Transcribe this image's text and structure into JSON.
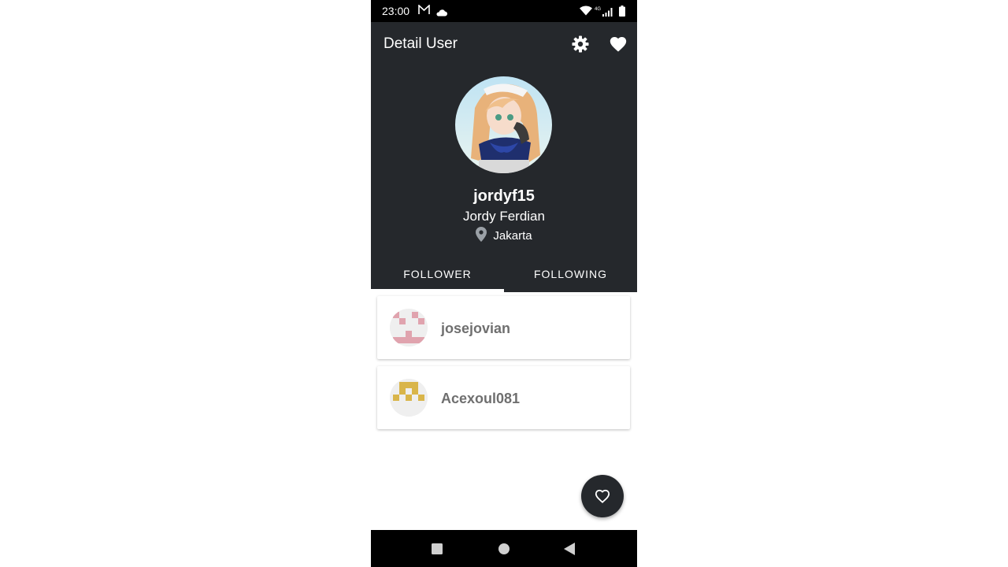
{
  "status_bar": {
    "time": "23:00",
    "icons": [
      "gmail-icon",
      "cloud-icon",
      "wifi-icon",
      "network-4g-icon",
      "signal-icon",
      "battery-icon"
    ],
    "network_label": "4G"
  },
  "app_bar": {
    "title": "Detail User",
    "actions": [
      "settings-icon",
      "favorite-icon"
    ]
  },
  "profile": {
    "username": "jordyf15",
    "full_name": "Jordy Ferdian",
    "location": "Jakarta"
  },
  "tabs": [
    {
      "label": "FOLLOWER",
      "selected": true
    },
    {
      "label": "FOLLOWING",
      "selected": false
    }
  ],
  "users": [
    {
      "login": "josejovian",
      "avatar_color": "#e0a3ae"
    },
    {
      "login": "Acexoul081",
      "avatar_color": "#d9b54a"
    }
  ],
  "fab": {
    "icon": "heart-outline-icon"
  },
  "nav_bar": {
    "buttons": [
      "recents-icon",
      "home-icon",
      "back-icon"
    ]
  },
  "colors": {
    "primary_dark": "#25282c",
    "status_bar": "#000000",
    "name_text": "#6f6f6f"
  }
}
